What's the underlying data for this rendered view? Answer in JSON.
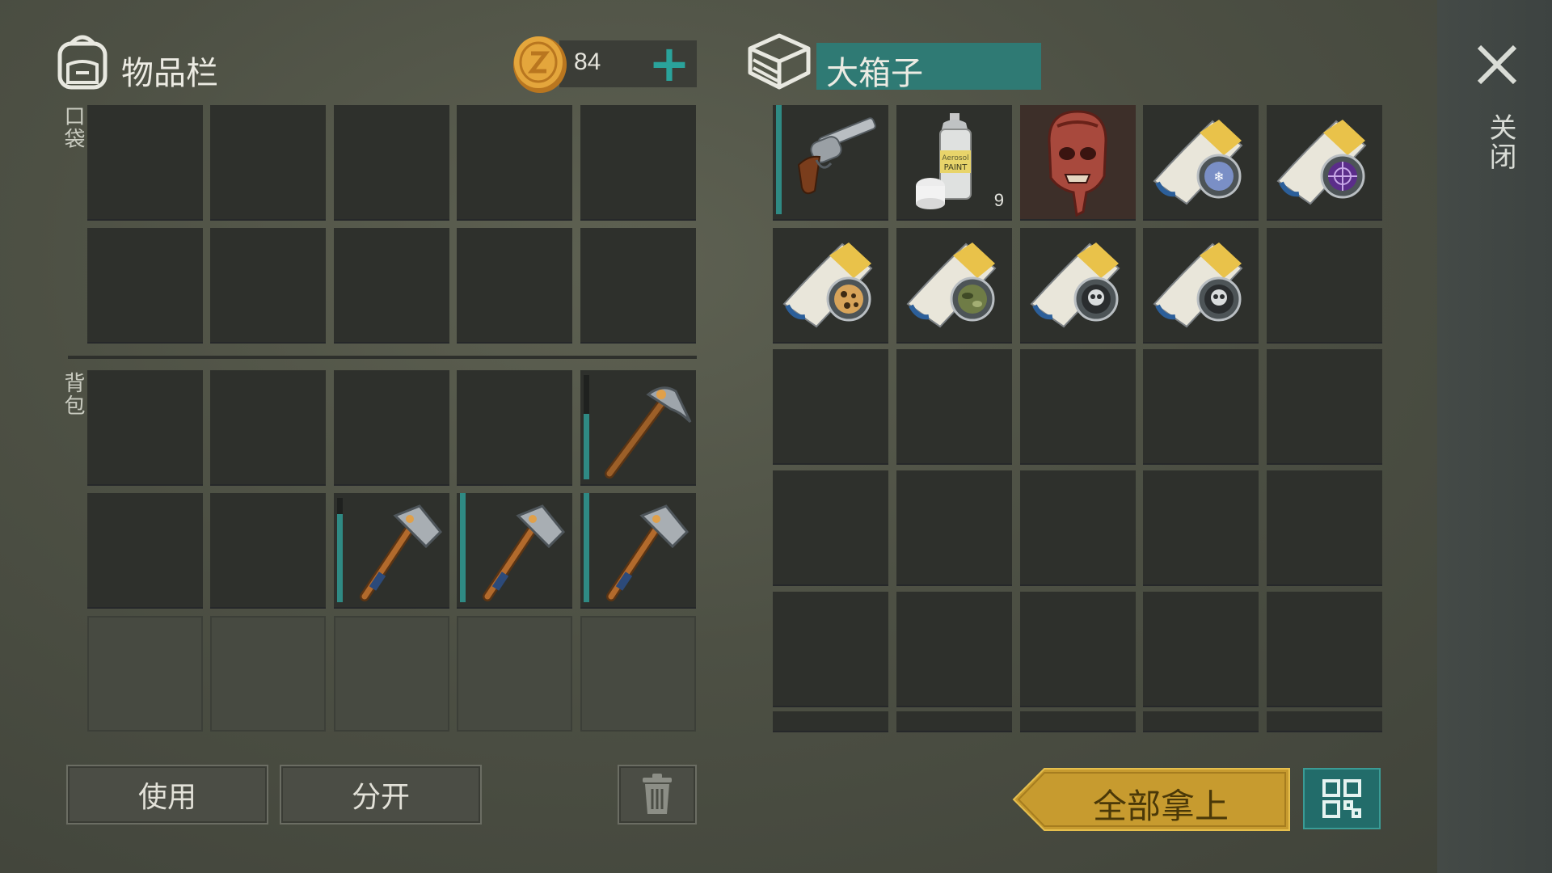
{
  "inventory": {
    "title": "物品栏",
    "pocket_label": "口袋",
    "backpack_label": "背包",
    "coins": "84",
    "add_coins_symbol": "+"
  },
  "container": {
    "title": "大箱子",
    "items": [
      {
        "name": "revolver",
        "qty": ""
      },
      {
        "name": "aerosol-paint",
        "qty": "9",
        "can_label": "Aerosol PAINT"
      },
      {
        "name": "zombie-mask",
        "qty": ""
      },
      {
        "name": "magazine-snowflake",
        "qty": ""
      },
      {
        "name": "magazine-spiderweb",
        "qty": ""
      },
      {
        "name": "magazine-leopard",
        "qty": ""
      },
      {
        "name": "magazine-camo",
        "qty": ""
      },
      {
        "name": "magazine-skull",
        "qty": ""
      },
      {
        "name": "magazine-skull",
        "qty": ""
      }
    ]
  },
  "backpack_items": [
    {
      "name": "pickaxe",
      "slot": "row1-col5",
      "durability": 0.6
    },
    {
      "name": "hatchet",
      "slot": "row2-col3",
      "durability": 0.8
    },
    {
      "name": "hatchet",
      "slot": "row2-col4",
      "durability": 1.0
    },
    {
      "name": "hatchet",
      "slot": "row2-col5",
      "durability": 1.0
    }
  ],
  "revolver_durability": 1.0,
  "buttons": {
    "use": "使用",
    "split": "分开",
    "take_all": "全部拿上",
    "close": "关闭"
  },
  "icons": {
    "backpack": "backpack-icon",
    "coin": "coin-icon",
    "crate": "crate-icon",
    "trash": "trash-icon",
    "sort": "sort-grid-icon",
    "close": "close-x-icon"
  },
  "colors": {
    "accent_teal": "#2f8a84",
    "take_all_gold": "#c9a033",
    "coin_gold": "#d9a23a"
  }
}
